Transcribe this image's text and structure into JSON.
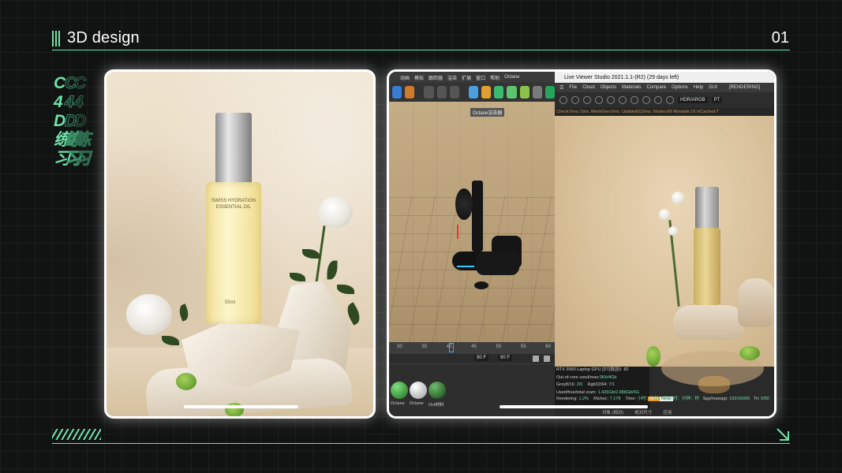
{
  "header": {
    "title": "3D design",
    "page_number": "01"
  },
  "side_label": [
    "C",
    "4",
    "D",
    "练",
    "习"
  ],
  "product": {
    "label_line1": "SWISS HYDRATION",
    "label_line2": "ESSENTIAL OIL",
    "volume": "55ml"
  },
  "c4d": {
    "menu": [
      "动画",
      "模拟",
      "跟踪器",
      "渲染",
      "扩展",
      "窗口",
      "帮助",
      "Octane"
    ],
    "viewport_tag": "Octane渲染器",
    "timeline_ticks": [
      "30",
      "35",
      "40",
      "45",
      "50",
      "55",
      "60"
    ],
    "frame_field_1": "90 F",
    "frame_field_2": "90 F",
    "materials": [
      "Octane",
      "Octane",
      "Oct材料"
    ]
  },
  "live_viewer": {
    "title": "Live Viewer Studio 2021.1.1-(R2) (29 days left)",
    "menu": [
      "File",
      "Cloud",
      "Objects",
      "Materials",
      "Compare",
      "Options",
      "Help",
      "GUI"
    ],
    "status_right": "[RENDERING]",
    "color_mode": "HDR/ARGB",
    "kernel": "PT",
    "status_line": "Check:0ms./1ms. MeshGen:0ms. Update[G]:0ms. Nodes:68 Movable:16 txCached:7",
    "gpu_name": "RTX 3060 Laptop GPU [DT]独显0",
    "gpu_value": "82",
    "out_of_core_label": "Out-of-core used/max:",
    "out_of_core_value": "0Kb/4Gb",
    "grey_label": "Grey8/16:",
    "grey_value": "2/0",
    "rgb_label": "Rgb32/64:",
    "rgb_value": "7/1",
    "vram_label": "Used/free/total vram:",
    "vram_value": "1.426Gb/2.886Gb/6G",
    "mem_tag_1": "Mem",
    "mem_tag_2": "Noise",
    "rendering_label": "Rendering:",
    "rendering_value": "1.2%",
    "mssec_label": "Ms/sec:",
    "mssec_value": "7.178",
    "time_label": "Time:",
    "time_value": "小时：分钟：秒/小时：分钟：秒",
    "spp_label": "Spp/maxspp:",
    "spp_value": "192/16000",
    "tri_label": "Tri:",
    "tri_value": "0/50",
    "bottom_items": [
      "对象 (相对)",
      "绝对尺寸",
      "应用"
    ]
  }
}
